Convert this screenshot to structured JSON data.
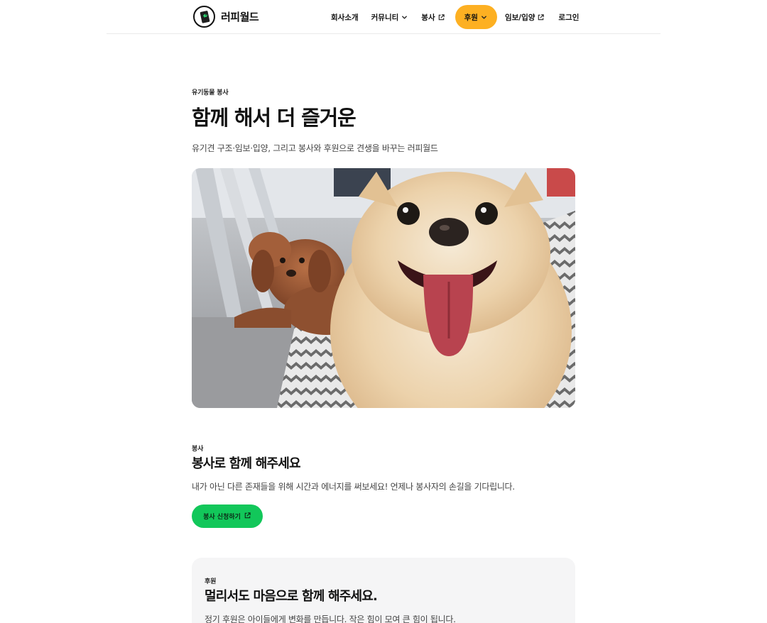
{
  "header": {
    "logo_text": "러피월드",
    "nav": [
      {
        "label": "회사소개"
      },
      {
        "label": "커뮤니티"
      },
      {
        "label": "봉사"
      },
      {
        "label": "후원"
      },
      {
        "label": "임보/입양"
      },
      {
        "label": "로그인"
      }
    ]
  },
  "hero": {
    "eyebrow": "유기동물 봉사",
    "title": "함께 해서 더 즐거운",
    "subtitle": "유기견 구조·임보·입양, 그리고 봉사와 후원으로 견생을 바꾸는 러피월드"
  },
  "volunteer": {
    "eyebrow": "봉사",
    "title": "봉사로 함께 해주세요",
    "description": "내가 아닌 다른 존재들을 위해 시간과 에너지를 써보세요! 언제나 봉사자의 손길을 기다립니다.",
    "button_label": "봉사 신청하기"
  },
  "donate": {
    "eyebrow": "후원",
    "title": "멀리서도 마음으로 함께 해주세요.",
    "description": "정기 후원은 아이들에게 변화를 만듭니다. 작은 힘이 모여 큰 힘이 됩니다."
  },
  "colors": {
    "donate_accent": "#fdb022",
    "volunteer_accent": "#12c75a",
    "card_bg": "#f5f5f6"
  },
  "icons": [
    "logo-dog-icon",
    "chevron-down-icon",
    "external-link-icon"
  ]
}
